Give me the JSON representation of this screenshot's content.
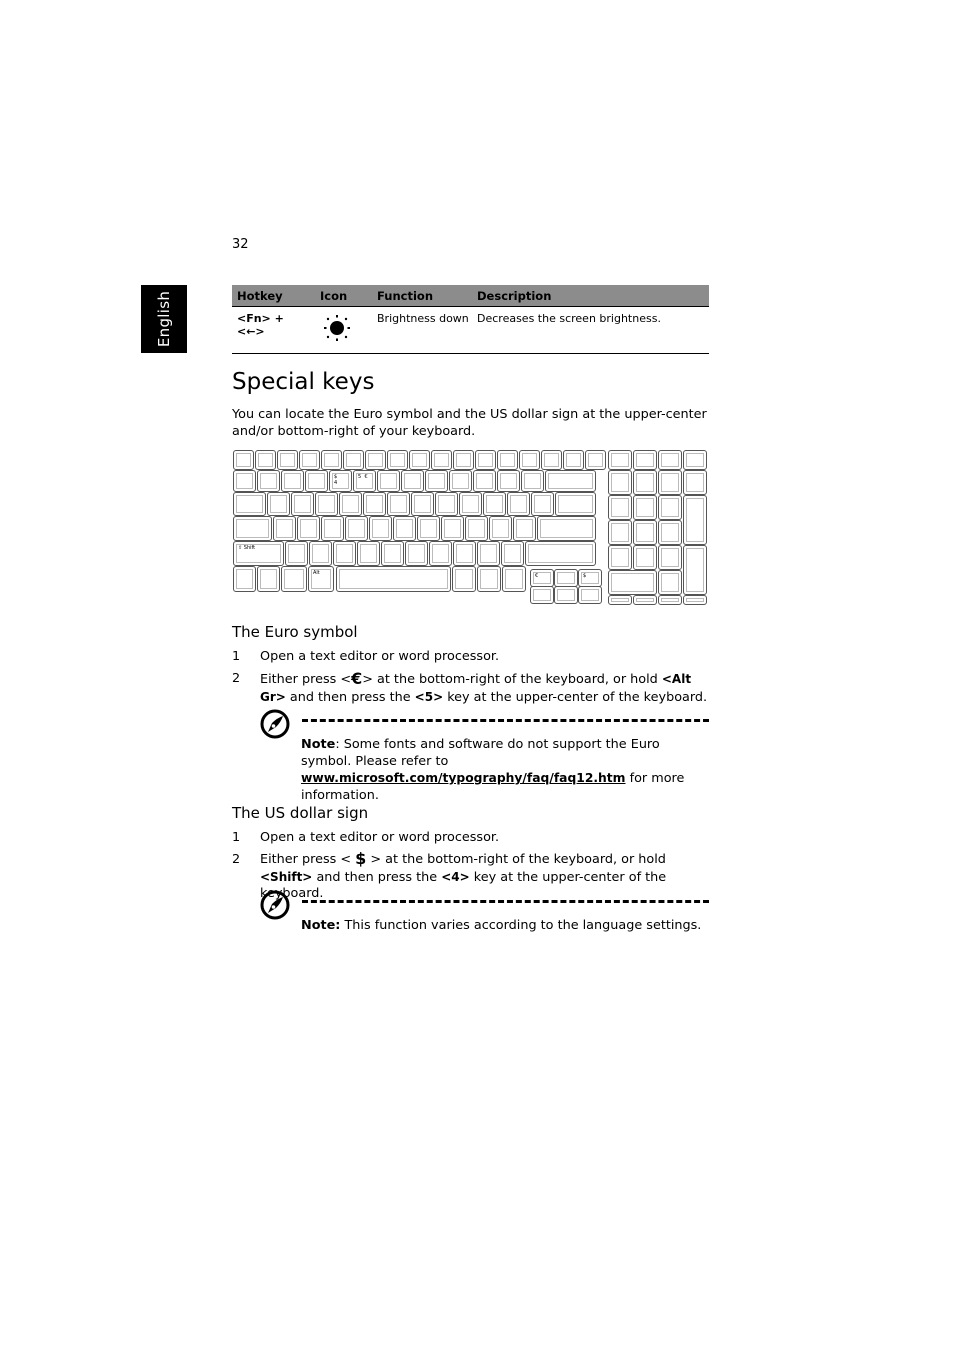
{
  "page": {
    "number": "32",
    "language_tab": "English"
  },
  "hotkey_table": {
    "headers": [
      "Hotkey",
      "Icon",
      "Function",
      "Description"
    ],
    "rows": [
      {
        "hotkey": "<Fn> + <←>",
        "icon": "brightness-down-icon",
        "function": "Brightness down",
        "description": "Decreases the screen brightness."
      }
    ]
  },
  "special_keys": {
    "title": "Special keys",
    "intro": "You can locate the Euro symbol and the US dollar sign at the upper-center and/or bottom-right of your keyboard.",
    "keyboard_legends": {
      "key_4": "$\n4",
      "key_5": "5  €",
      "shift": "⇧ Shift",
      "alt": "Alt",
      "euro_key": "€",
      "dollar_key": "$"
    }
  },
  "euro_section": {
    "heading": "The Euro symbol",
    "steps": [
      {
        "num": "1",
        "text": "Open a text editor or word processor."
      },
      {
        "num": "2",
        "pre": "Either press <",
        "symbol": "€",
        "mid": "> at the bottom-right of the keyboard, or hold ",
        "key1": "<Alt Gr>",
        "mid2": " and then press the ",
        "key2": "<5>",
        "post": " key at the upper-center of the keyboard."
      }
    ],
    "note": {
      "label": "Note",
      "text1": ": Some fonts and software do not support the Euro symbol. Please refer to ",
      "link": "www.microsoft.com/typography/faq/faq12.htm",
      "text2": " for more information."
    }
  },
  "dollar_section": {
    "heading": "The US dollar sign",
    "steps": [
      {
        "num": "1",
        "text": "Open a text editor or word processor."
      },
      {
        "num": "2",
        "pre": "Either press < ",
        "symbol": "$",
        "mid": " > at the bottom-right of the keyboard, or hold ",
        "key1": "<Shift>",
        "mid2": " and then press the ",
        "key2": "<4>",
        "post": " key at the upper-center of the keyboard."
      }
    ],
    "note": {
      "label": "Note:",
      "text1": " This function varies according to the language settings."
    }
  }
}
